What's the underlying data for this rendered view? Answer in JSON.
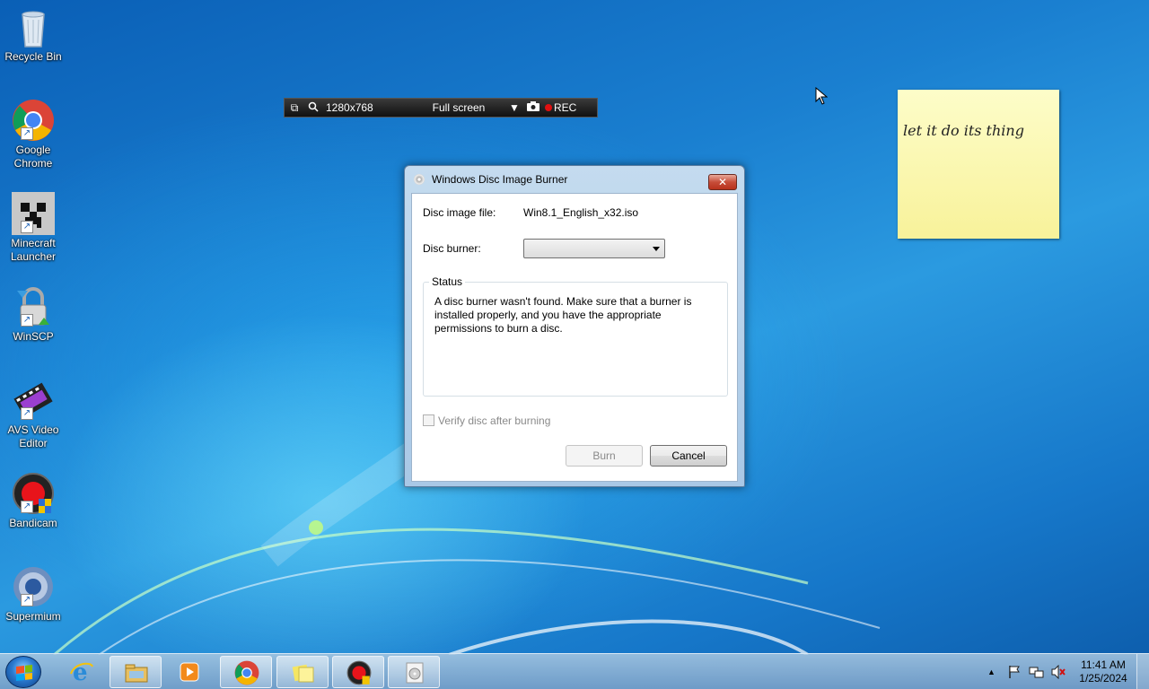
{
  "desktop": {
    "icons": [
      {
        "label": "Recycle Bin",
        "icon": "recycle-bin-icon"
      },
      {
        "label": "Google Chrome",
        "icon": "chrome-icon"
      },
      {
        "label": "Minecraft Launcher",
        "icon": "minecraft-icon"
      },
      {
        "label": "WinSCP",
        "icon": "winscp-icon"
      },
      {
        "label": "AVS Video Editor",
        "icon": "avs-video-editor-icon"
      },
      {
        "label": "Bandicam",
        "icon": "bandicam-icon"
      },
      {
        "label": "Supermium",
        "icon": "supermium-icon"
      }
    ]
  },
  "bandicam_bar": {
    "resolution": "1280x768",
    "mode": "Full screen",
    "rec_label": "REC"
  },
  "sticky_note": {
    "text": "let it do its thing"
  },
  "dialog": {
    "title": "Windows Disc Image Burner",
    "close_label": "✕",
    "disc_image_label": "Disc image file:",
    "disc_image_value": "Win8.1_English_x32.iso",
    "disc_burner_label": "Disc burner:",
    "disc_burner_value": "",
    "status_legend": "Status",
    "status_text": "A disc burner wasn't found. Make sure that a burner is installed properly, and you have the appropriate permissions to burn a disc.",
    "verify_label": "Verify disc after burning",
    "verify_checked": false,
    "burn_label": "Burn",
    "cancel_label": "Cancel"
  },
  "taskbar": {
    "pinned": [
      {
        "name": "internet-explorer-icon",
        "active": false
      },
      {
        "name": "file-explorer-icon",
        "active": true
      },
      {
        "name": "media-player-icon",
        "active": false
      },
      {
        "name": "chrome-icon",
        "active": true
      },
      {
        "name": "sticky-notes-icon",
        "active": true
      },
      {
        "name": "bandicam-icon",
        "active": true
      },
      {
        "name": "disc-image-burner-icon",
        "active": true
      }
    ],
    "clock_time": "11:41 AM",
    "clock_date": "1/25/2024"
  },
  "colors": {
    "accent": "#1a7fd0",
    "sticky": "#f8f29a",
    "close": "#c74d3a"
  }
}
